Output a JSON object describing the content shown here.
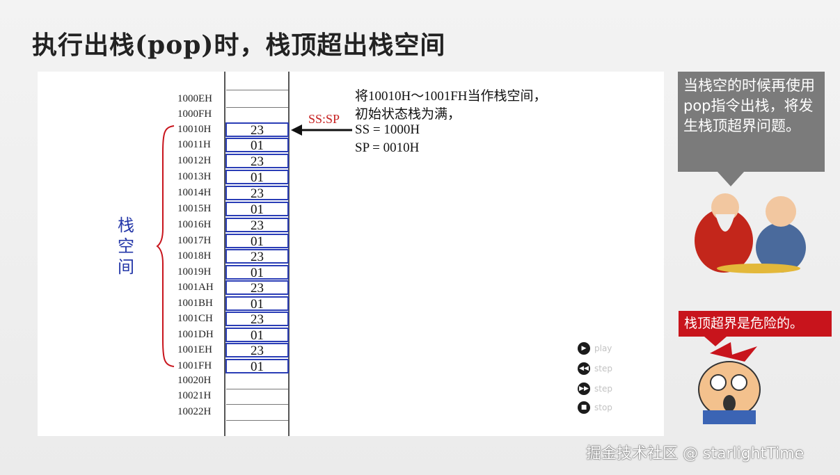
{
  "title": "执行出栈(pop)时，栈顶超出栈空间",
  "stack": {
    "addresses": [
      "1000EH",
      "1000FH",
      "10010H",
      "10011H",
      "10012H",
      "10013H",
      "10014H",
      "10015H",
      "10016H",
      "10017H",
      "10018H",
      "10019H",
      "1001AH",
      "1001BH",
      "1001CH",
      "1001DH",
      "1001EH",
      "1001FH",
      "10020H",
      "10021H",
      "10022H"
    ],
    "cells": [
      "",
      "",
      "23",
      "01",
      "23",
      "01",
      "23",
      "01",
      "23",
      "01",
      "23",
      "01",
      "23",
      "01",
      "23",
      "01",
      "23",
      "01",
      "",
      "",
      ""
    ],
    "pointer_label": "SS:SP",
    "vertical_label": [
      "栈",
      "空",
      "间"
    ]
  },
  "description": [
    "将10010H～1001FH当作栈空间，",
    "初始状态栈为满，",
    "SS = 1000H",
    "SP = 0010H"
  ],
  "controls": [
    {
      "icon": "play-icon",
      "label": "play"
    },
    {
      "icon": "step-back-icon",
      "label": "step"
    },
    {
      "icon": "step-forward-icon",
      "label": "step"
    },
    {
      "icon": "stop-icon",
      "label": "stop"
    }
  ],
  "bubble_text": "当栈空的时候再使用pop指令出栈，将发生栈顶超界问题。",
  "warning_text": "栈顶超界是危险的。",
  "watermark": "掘金技术社区 @ starlightTime",
  "colors": {
    "accent_red": "#c8141c",
    "cell_border": "#2a3db6",
    "label_blue": "#2437a8",
    "bubble_gray": "#7b7b7b"
  }
}
